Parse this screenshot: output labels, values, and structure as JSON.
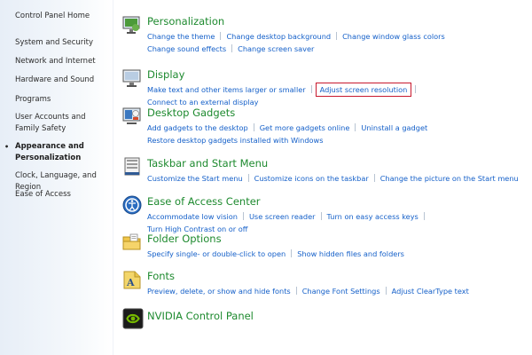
{
  "sidebar": {
    "home": "Control Panel Home",
    "items": [
      {
        "label": "System and Security"
      },
      {
        "label": "Network and Internet"
      },
      {
        "label": "Hardware and Sound"
      },
      {
        "label": "Programs"
      },
      {
        "label": "User Accounts and Family Safety"
      },
      {
        "label": "Appearance and Personalization"
      },
      {
        "label": "Clock, Language, and Region"
      },
      {
        "label": "Ease of Access"
      }
    ]
  },
  "categories": [
    {
      "title": "Personalization",
      "icon": "personalization-icon",
      "links": [
        "Change the theme",
        "Change desktop background",
        "Change window glass colors",
        "Change sound effects",
        "Change screen saver"
      ]
    },
    {
      "title": "Display",
      "icon": "display-monitor-icon",
      "links": [
        "Make text and other items larger or smaller",
        "Adjust screen resolution",
        "Connect to an external display"
      ]
    },
    {
      "title": "Desktop Gadgets",
      "icon": "desktop-gadgets-icon",
      "links": [
        "Add gadgets to the desktop",
        "Get more gadgets online",
        "Uninstall a gadget",
        "Restore desktop gadgets installed with Windows"
      ]
    },
    {
      "title": "Taskbar and Start Menu",
      "icon": "taskbar-icon",
      "links": [
        "Customize the Start menu",
        "Customize icons on the taskbar",
        "Change the picture on the Start menu"
      ]
    },
    {
      "title": "Ease of Access Center",
      "icon": "ease-of-access-icon",
      "links": [
        "Accommodate low vision",
        "Use screen reader",
        "Turn on easy access keys",
        "Turn High Contrast on or off"
      ]
    },
    {
      "title": "Folder Options",
      "icon": "folder-options-icon",
      "links": [
        "Specify single- or double-click to open",
        "Show hidden files and folders"
      ]
    },
    {
      "title": "Fonts",
      "icon": "fonts-icon",
      "links": [
        "Preview, delete, or show and hide fonts",
        "Change Font Settings",
        "Adjust ClearType text"
      ]
    },
    {
      "title": "NVIDIA Control Panel",
      "icon": "nvidia-icon",
      "links": []
    }
  ],
  "highlight_color": "#c8192e",
  "link_color": "#1560c9",
  "title_color": "#1e8a2f"
}
